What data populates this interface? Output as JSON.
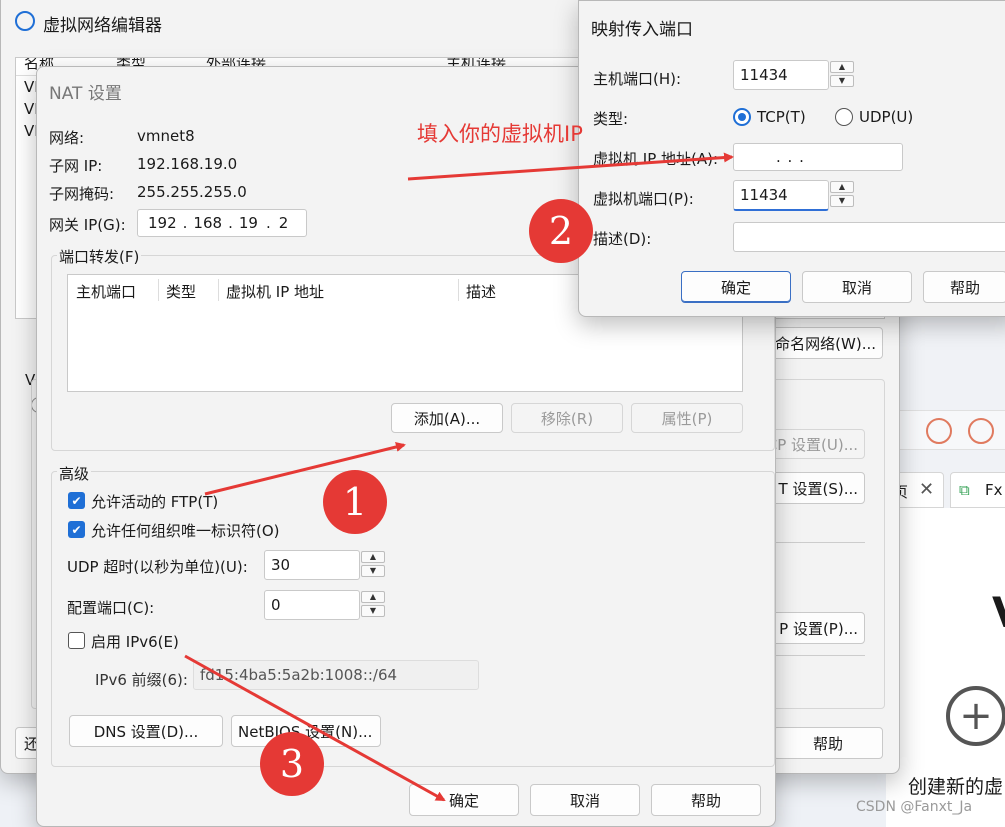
{
  "main_window": {
    "title": "虚拟网络编辑器",
    "list_headers": [
      "名称",
      "类型",
      "外部连接",
      "主机连接"
    ],
    "list_rows_prefix": [
      "VI",
      "VI",
      "VI"
    ],
    "partial_vm_label": "VI",
    "partial_bottom_left": "还",
    "rename_button": "命名网络(W)...",
    "settings_u_button": "DHCP 设置(U)...",
    "nat_settings_button": "T 设置(S)...",
    "dhcp_settings_button": "P 设置(P)...",
    "help_button": "帮助"
  },
  "background_app": {
    "tab_partial": "页",
    "tab2_label": "Fx",
    "create_new_label": "创建新的虚",
    "big_letter": "V"
  },
  "nat_dialog": {
    "title": "NAT 设置",
    "network_label": "网络:",
    "network_value": "vmnet8",
    "subnet_ip_label": "子网 IP:",
    "subnet_ip_value": "192.168.19.0",
    "subnet_mask_label": "子网掩码:",
    "subnet_mask_value": "255.255.255.0",
    "gateway_label": "网关 IP(G):",
    "gateway_octets": [
      "192",
      "168",
      "19",
      "2"
    ],
    "port_forward_legend": "端口转发(F)",
    "port_forward_columns": [
      "主机端口",
      "类型",
      "虚拟机 IP 地址",
      "描述"
    ],
    "add_button": "添加(A)...",
    "remove_button": "移除(R)",
    "properties_button": "属性(P)",
    "advanced_legend": "高级",
    "allow_ftp_label": "允许活动的 FTP(T)",
    "allow_ftp_checked": true,
    "allow_oui_label": "允许任何组织唯一标识符(O)",
    "allow_oui_checked": true,
    "udp_timeout_label": "UDP 超时(以秒为单位)(U):",
    "udp_timeout_value": "30",
    "config_port_label": "配置端口(C):",
    "config_port_value": "0",
    "enable_ipv6_label": "启用 IPv6(E)",
    "enable_ipv6_checked": false,
    "ipv6_prefix_label": "IPv6 前缀(6):",
    "ipv6_prefix_value": "fd15:4ba5:5a2b:1008::/64",
    "dns_button": "DNS 设置(D)...",
    "netbios_button": "NetBIOS 设置(N)...",
    "ok_button": "确定",
    "cancel_button": "取消",
    "help_button": "帮助"
  },
  "port_dialog": {
    "title": "映射传入端口",
    "host_port_label": "主机端口(H):",
    "host_port_value": "11434",
    "type_label": "类型:",
    "tcp_label": "TCP(T)",
    "udp_label": "UDP(U)",
    "selected_type": "TCP",
    "vm_ip_label": "虚拟机 IP 地址(A):",
    "vm_ip_dots": ".      .      .",
    "vm_port_label": "虚拟机端口(P):",
    "vm_port_value": "11434",
    "description_label": "描述(D):",
    "description_value": "",
    "ok_button": "确定",
    "cancel_button": "取消",
    "help_button": "帮助"
  },
  "annotations": {
    "instruction_text": "填入你的虚拟机IP",
    "markers": [
      "1",
      "2",
      "3"
    ],
    "color": "#e53935"
  },
  "watermark": "CSDN @Fanxt_Ja"
}
